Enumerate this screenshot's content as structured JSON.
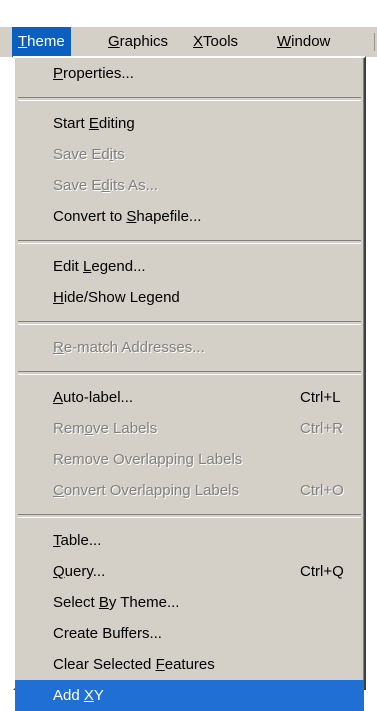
{
  "menubar": {
    "items": [
      {
        "pre": "",
        "u": "T",
        "post": "heme",
        "active": true
      },
      {
        "pre": "",
        "u": "G",
        "post": "raphics",
        "active": false
      },
      {
        "pre": "",
        "u": "X",
        "post": "Tools",
        "active": false
      },
      {
        "pre": "",
        "u": "W",
        "post": "indow",
        "active": false
      }
    ]
  },
  "menu": {
    "items": [
      {
        "pre": "",
        "u": "P",
        "post": "roperties...",
        "shortcut": "",
        "enabled": true
      },
      {
        "separator": true
      },
      {
        "pre": "Start ",
        "u": "E",
        "post": "diting",
        "shortcut": "",
        "enabled": true
      },
      {
        "pre": "Save Ed",
        "u": "i",
        "post": "ts",
        "shortcut": "",
        "enabled": false
      },
      {
        "pre": "Save E",
        "u": "d",
        "post": "its As...",
        "shortcut": "",
        "enabled": false
      },
      {
        "pre": "Convert to ",
        "u": "S",
        "post": "hapefile...",
        "shortcut": "",
        "enabled": true
      },
      {
        "separator": true
      },
      {
        "pre": "Edit ",
        "u": "L",
        "post": "egend...",
        "shortcut": "",
        "enabled": true
      },
      {
        "pre": "",
        "u": "H",
        "post": "ide/Show Legend",
        "shortcut": "",
        "enabled": true
      },
      {
        "separator": true
      },
      {
        "pre": "",
        "u": "R",
        "post": "e-match Addresses...",
        "shortcut": "",
        "enabled": false
      },
      {
        "separator": true
      },
      {
        "pre": "",
        "u": "A",
        "post": "uto-label...",
        "shortcut": "Ctrl+L",
        "enabled": true
      },
      {
        "pre": "Rem",
        "u": "o",
        "post": "ve Labels",
        "shortcut": "Ctrl+R",
        "enabled": false
      },
      {
        "pre": "Remove Overlapping Labels",
        "u": "",
        "post": "",
        "shortcut": "",
        "enabled": false
      },
      {
        "pre": "",
        "u": "C",
        "post": "onvert Overlapping Labels",
        "shortcut": "Ctrl+O",
        "enabled": false
      },
      {
        "separator": true
      },
      {
        "pre": "",
        "u": "T",
        "post": "able...",
        "shortcut": "",
        "enabled": true
      },
      {
        "pre": "",
        "u": "Q",
        "post": "uery...",
        "shortcut": "Ctrl+Q",
        "enabled": true
      },
      {
        "pre": "Select ",
        "u": "B",
        "post": "y Theme...",
        "shortcut": "",
        "enabled": true
      },
      {
        "pre": "Create Buffers...",
        "u": "",
        "post": "",
        "shortcut": "",
        "enabled": true
      },
      {
        "pre": "Clear Selected ",
        "u": "F",
        "post": "eatures",
        "shortcut": "",
        "enabled": true
      },
      {
        "pre": "Add ",
        "u": "X",
        "post": "Y",
        "shortcut": "",
        "enabled": true,
        "selected": true
      }
    ]
  },
  "colors": {
    "menu_face": "#d4d0c8",
    "highlight": "#1f6fd4",
    "disabled_text": "#808080"
  }
}
